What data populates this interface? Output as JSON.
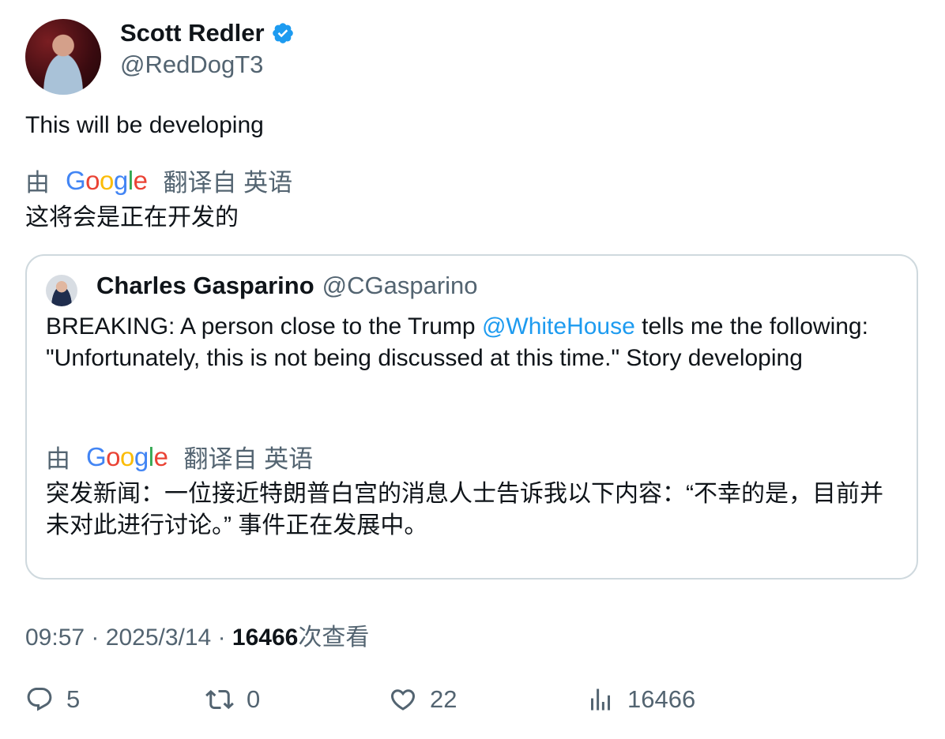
{
  "author": {
    "display_name": "Scott Redler",
    "handle": "@RedDogT3",
    "verified": true
  },
  "tweet": {
    "text": "This will be developing",
    "translation": {
      "prefix": "由",
      "provider": "Google",
      "suffix": "翻译自 英语",
      "text": "这将会是正在开发的"
    }
  },
  "quoted_tweet": {
    "display_name": "Charles Gasparino",
    "handle": "@CGasparino",
    "text_before_mention": "BREAKING: A person close to the Trump ",
    "mention": "@WhiteHouse",
    "text_after_mention": " tells me the following: \"Unfortunately, this is not being discussed at this time.\" Story developing",
    "translation": {
      "prefix": "由",
      "provider": "Google",
      "suffix": "翻译自 英语",
      "text": "突发新闻：一位接近特朗普白宫的消息人士告诉我以下内容：“不幸的是，目前并未对此进行讨论。” 事件正在发展中。"
    }
  },
  "meta": {
    "time": "09:57",
    "separator": "·",
    "date": "2025/3/14",
    "views": "16466",
    "views_label": "次查看"
  },
  "actions": {
    "replies": "5",
    "retweets": "0",
    "likes": "22",
    "views": "16466"
  },
  "colors": {
    "verified": "#1d9bf0",
    "mention": "#1d9bf0",
    "secondary_text": "#536471",
    "border": "#cfd9de"
  },
  "icons": [
    "verified-badge-icon",
    "reply-icon",
    "retweet-icon",
    "like-icon",
    "views-icon"
  ]
}
